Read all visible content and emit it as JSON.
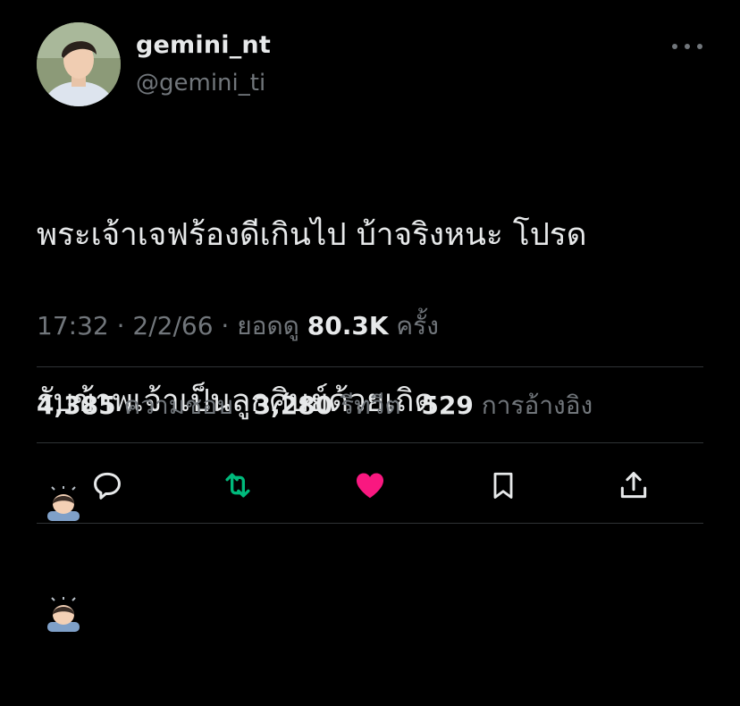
{
  "user": {
    "display_name": "gemini_nt",
    "handle": "@gemini_ti"
  },
  "tweet": {
    "line1": "พระเจ้าเจฟร้องดีเกินไป บ้าจริงหนะ โปรด",
    "line2": "รับข้าพเจ้าเป็นลูกศิษย์ด้วยเถิด",
    "emojis": [
      "bowing-man-emoji",
      "bowing-man-emoji"
    ]
  },
  "meta": {
    "time": "17:32",
    "sep1": " · ",
    "date": "2/2/66",
    "sep2": " · ",
    "views_label": "ยอดดู",
    "views_count": "80.3K",
    "views_unit": "ครั้ง"
  },
  "stats": {
    "likes_count": "4,385",
    "likes_label": "ความชอบ",
    "retweets_count": "3,280",
    "retweets_label": "รีทวีต",
    "quotes_count": "529",
    "quotes_label": "การอ้างอิง"
  },
  "actions": {
    "reply_icon": "reply-icon",
    "retweet_icon": "retweet-icon",
    "like_icon": "heart-icon",
    "bookmark_icon": "bookmark-icon",
    "share_icon": "share-icon"
  },
  "colors": {
    "background": "#000000",
    "text": "#e7e9ea",
    "muted": "#71767b",
    "retweet_green": "#00ba7c",
    "like_pink": "#f91880"
  }
}
